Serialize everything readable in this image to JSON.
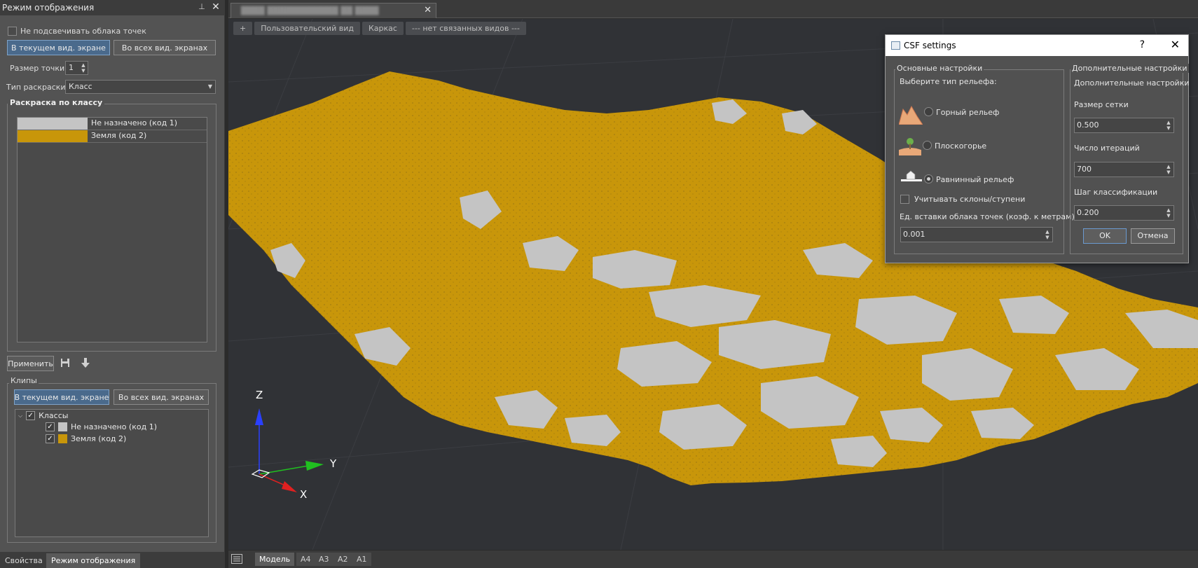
{
  "left_panel": {
    "title": "Режим отображения",
    "no_highlight_label": "Не подсвечивать облака точек",
    "btn_current_view": "В текущем вид. экране",
    "btn_all_views": "Во всех вид. экранах",
    "point_size_label": "Размер точки:",
    "point_size_value": "1",
    "color_type_label": "Тип раскраски:",
    "color_type_value": "Класс",
    "group_class_title": "Раскраска по классу",
    "classes": [
      {
        "name": "Не назначено (код 1)",
        "color": "#c4c4c4"
      },
      {
        "name": "Земля (код 2)",
        "color": "#c8960a"
      }
    ],
    "apply_label": "Применить",
    "clips_title": "Клипы",
    "clips_btn_current": "В текущем вид. экране",
    "clips_btn_all": "Во всех вид. экранах",
    "tree": {
      "root": "Классы",
      "items": [
        {
          "name": "Не назначено (код 1)",
          "color": "#c4c4c4"
        },
        {
          "name": "Земля (код 2)",
          "color": "#c8960a"
        }
      ]
    },
    "bottom_tabs": [
      "Свойства",
      "Режим отображения"
    ]
  },
  "viewport": {
    "toolbar": [
      "+",
      "Пользовательский вид",
      "Каркас",
      "--- нет связанных видов ---"
    ],
    "axes": {
      "z": "Z",
      "y": "Y",
      "x": "X"
    },
    "layout_tabs": [
      "Модель",
      "A4",
      "A3",
      "A2",
      "A1"
    ]
  },
  "csf": {
    "title": "CSF settings",
    "help": "?",
    "basic_group": "Основные настройки",
    "terrain_prompt": "Выберите тип рельефа:",
    "terrain_options": [
      "Горный рельеф",
      "Плоскогорье",
      "Равнинный рельеф"
    ],
    "slope_label": "Учитывать склоны/ступени",
    "insert_unit_label": "Ед. вставки облака точек (коэф. к метрам)",
    "insert_unit_value": "0.001",
    "advanced_group": "Дополнительные настройки",
    "advanced_sub": "Дополнительные настройки",
    "grid_label": "Размер сетки",
    "grid_value": "0.500",
    "iter_label": "Число итераций",
    "iter_value": "700",
    "step_label": "Шаг классификации",
    "step_value": "0.200",
    "ok": "OK",
    "cancel": "Отмена"
  },
  "colors": {
    "ground": "#c8960a",
    "unassigned": "#c4c4c4"
  }
}
